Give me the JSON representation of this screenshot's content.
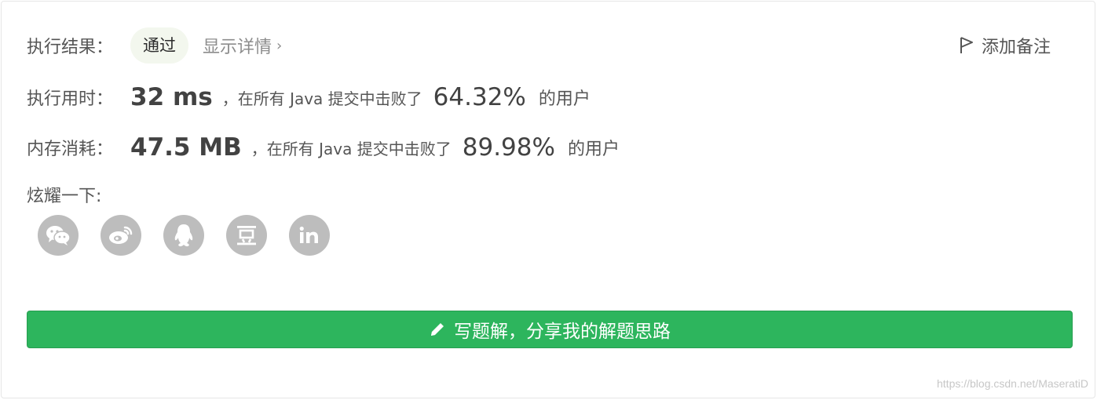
{
  "result": {
    "label": "执行结果：",
    "status": "通过",
    "details_link": "显示详情",
    "details_chevron": "›"
  },
  "add_note": {
    "label": "添加备注",
    "icon": "flag-icon"
  },
  "runtime": {
    "label": "执行用时：",
    "value": "32 ms",
    "mid_text_1": "，在所有",
    "language": "Java",
    "mid_text_2": "提交中击败了",
    "percent": "64.32%",
    "tail": "的用户"
  },
  "memory": {
    "label": "内存消耗：",
    "value": "47.5 MB",
    "mid_text_1": "，在所有",
    "language": "Java",
    "mid_text_2": "提交中击败了",
    "percent": "89.98%",
    "tail": "的用户"
  },
  "share": {
    "label": "炫耀一下:",
    "icons": [
      "wechat-icon",
      "weibo-icon",
      "qq-icon",
      "douban-icon",
      "linkedin-icon"
    ],
    "linkedin_text": "in",
    "douban_text": "豆"
  },
  "write_solution": {
    "label": "写题解，分享我的解题思路",
    "icon": "pencil-icon"
  },
  "watermark": "https://blog.csdn.net/MaseratiD",
  "colors": {
    "accent_green": "#2db55d",
    "status_bg": "#f3f7ee",
    "icon_gray": "#bdbdbd",
    "text": "#555555"
  }
}
